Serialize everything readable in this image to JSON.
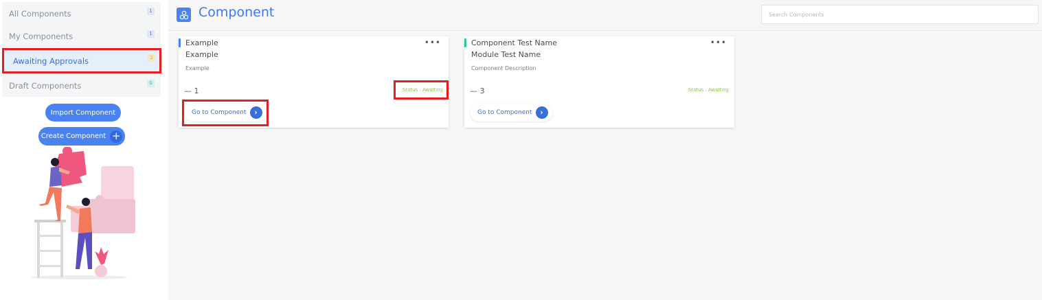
{
  "sidebar": {
    "items": [
      {
        "label": "All Components",
        "count": "1"
      },
      {
        "label": "My Components",
        "count": "1"
      },
      {
        "label": "Awaiting Approvals",
        "count": "2"
      },
      {
        "label": "Draft Components",
        "count": "0"
      }
    ],
    "import_label": "Import Component",
    "create_label": "Create Component",
    "create_icon": "+"
  },
  "header": {
    "title": "Component",
    "search_placeholder": "Search Components"
  },
  "cards": [
    {
      "name": "Example",
      "module": "Example",
      "description": "Example",
      "count_prefix": "—",
      "count": "1",
      "status": "Status : Awaiting",
      "go_label": "Go to Component",
      "accent_color": "#4a83f0"
    },
    {
      "name": "Component Test Name",
      "module": "Module Test Name",
      "description": "Component Description",
      "count_prefix": "—",
      "count": "3",
      "status": "Status : Awaiting",
      "go_label": "Go to Component",
      "accent_color": "#2fc49a"
    }
  ],
  "icons": {
    "menu": "•••",
    "arrow": "›"
  },
  "colors": {
    "accent": "#4a83f0",
    "highlight": "#e02020",
    "status": "#8ec34a"
  }
}
